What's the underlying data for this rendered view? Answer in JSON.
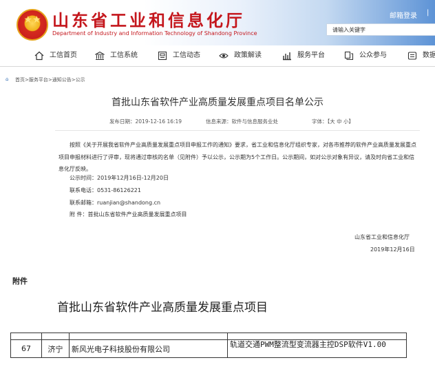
{
  "header": {
    "title_cn": "山东省工业和信息化厅",
    "title_en": "Department of Industry and Information Technology of Shandong Province",
    "login": "邮箱登录",
    "login_sep": "|",
    "search_placeholder": "请输入关键字"
  },
  "nav": [
    {
      "label": "工信首页",
      "icon": "home-icon"
    },
    {
      "label": "工信系统",
      "icon": "building-icon"
    },
    {
      "label": "工信动态",
      "icon": "news-icon"
    },
    {
      "label": "政策解读",
      "icon": "eye-icon"
    },
    {
      "label": "服务平台",
      "icon": "chart-icon"
    },
    {
      "label": "公众参与",
      "icon": "chat-icon"
    },
    {
      "label": "数据",
      "icon": "data-icon"
    }
  ],
  "breadcrumb": "首页>服务平台>通知公告>公示",
  "article": {
    "title": "首批山东省软件产业高质量发展重点项目名单公示",
    "publish_date": "发布日期：2019-12-16 16:19",
    "source": "信息来源：软件与信息服务业处",
    "font_size": "字体：【大 中 小】",
    "paragraph": "按照《关于开展我省软件产业高质量发展重点项目申报工作的通知》要求，省工业和信息化厅组织专家，对各市推荐的软件产业高质量发展重点项目申报材料进行了评审，现将通过审核的名单（见附件）予以公示，公示期为5个工作日。公示期间，如对公示对象有异议，请及时向省工业和信息化厅反映。",
    "period": "公示时间：2019年12月16日-12月20日",
    "phone": "联系电话：0531-86126221",
    "email": "联系邮箱：ruanjian@shandong.cn",
    "attachment": "附   件：首批山东省软件产业高质量发展重点项目",
    "signature_org": "山东省工业和信息化厅",
    "signature_date": "2019年12月16日"
  },
  "attachment_doc": {
    "label": "附件",
    "title": "首批山东省软件产业高质量发展重点项目",
    "rows": [
      {
        "no": "67",
        "city": "济宁",
        "company": "新风光电子科技股份有限公司",
        "software": "轨道交通PWM整流型变流器主控DSP软件V1.00"
      }
    ]
  },
  "colors": {
    "brand_red": "#c4161c",
    "link_blue": "#2d6ab2"
  }
}
